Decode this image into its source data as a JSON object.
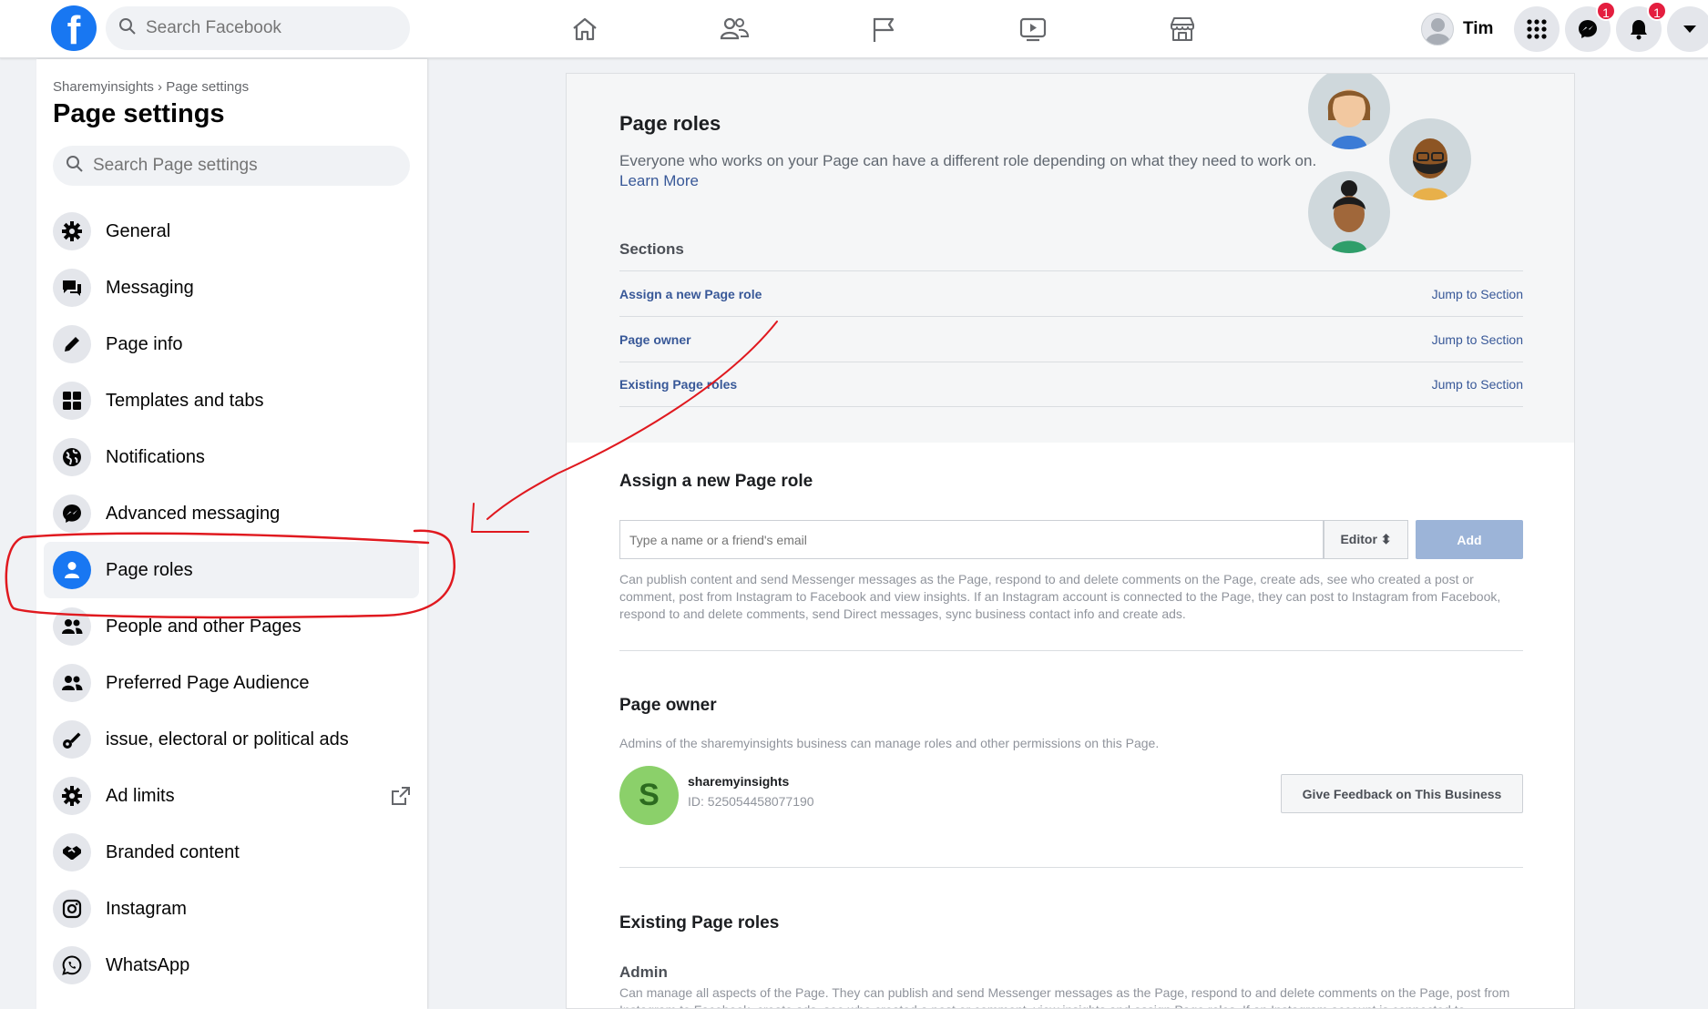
{
  "topbar": {
    "logo_letter": "f",
    "search_placeholder": "Search Facebook",
    "profile_name": "Tim",
    "messenger_badge": "1",
    "notifications_badge": "1"
  },
  "sidebar": {
    "breadcrumb": "Sharemyinsights › Page settings",
    "title": "Page settings",
    "search_placeholder": "Search Page settings",
    "items": [
      {
        "label": "General"
      },
      {
        "label": "Messaging"
      },
      {
        "label": "Page info"
      },
      {
        "label": "Templates and tabs"
      },
      {
        "label": "Notifications"
      },
      {
        "label": "Advanced messaging"
      },
      {
        "label": "Page roles"
      },
      {
        "label": "People and other Pages"
      },
      {
        "label": "Preferred Page Audience"
      },
      {
        "label": "issue, electoral or political ads"
      },
      {
        "label": "Ad limits"
      },
      {
        "label": "Branded content"
      },
      {
        "label": "Instagram"
      },
      {
        "label": "WhatsApp"
      }
    ]
  },
  "main": {
    "title": "Page roles",
    "description": "Everyone who works on your Page can have a different role depending on what they need to work on.",
    "learn_more": "Learn More",
    "sections_heading": "Sections",
    "sections": [
      {
        "label": "Assign a new Page role",
        "jump": "Jump to Section"
      },
      {
        "label": "Page owner",
        "jump": "Jump to Section"
      },
      {
        "label": "Existing Page roles",
        "jump": "Jump to Section"
      }
    ],
    "assign": {
      "heading": "Assign a new Page role",
      "input_placeholder": "Type a name or a friend's email",
      "role_select": "Editor ⬍",
      "add_label": "Add",
      "role_description": "Can publish content and send Messenger messages as the Page, respond to and delete comments on the Page, create ads, see who created a post or comment, post from Instagram to Facebook and view insights. If an Instagram account is connected to the Page, they can post to Instagram from Facebook, respond to and delete comments, send Direct messages, sync business contact info and create ads."
    },
    "owner": {
      "heading": "Page owner",
      "description": "Admins of the sharemyinsights business can manage roles and other permissions on this Page.",
      "avatar_letter": "S",
      "name": "sharemyinsights",
      "id_text": "ID: 525054458077190",
      "feedback_label": "Give Feedback on This Business"
    },
    "existing": {
      "heading": "Existing Page roles",
      "admin_heading": "Admin",
      "admin_description": "Can manage all aspects of the Page. They can publish and send Messenger messages as the Page, respond to and delete comments on the Page, post from Instagram to Facebook, create ads, see who created a post or comment, view insights and assign Page roles. If an Instagram account is connected to"
    }
  },
  "colors": {
    "accent": "#1877f2",
    "link": "#385898",
    "annotation": "#e0191f"
  }
}
